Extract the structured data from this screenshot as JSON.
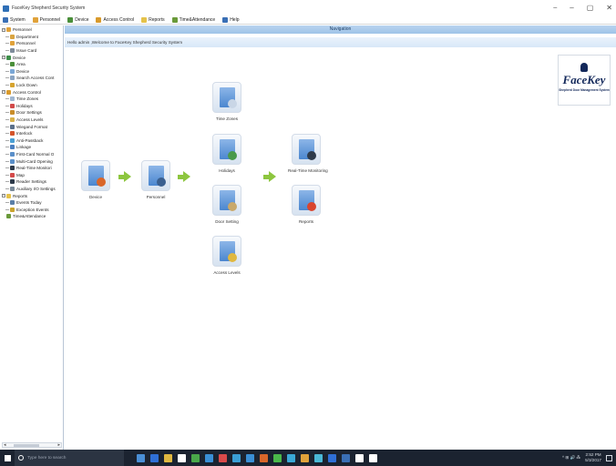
{
  "window": {
    "title": "FaceKey Shepherd Security System",
    "controls": [
      "⎯",
      "–",
      "▢",
      "✕"
    ]
  },
  "menu": [
    {
      "label": "System",
      "color": "#3a6fb5"
    },
    {
      "label": "Personnel",
      "color": "#e0a23a"
    },
    {
      "label": "Device",
      "color": "#4a8f3a"
    },
    {
      "label": "Access Control",
      "color": "#d99a2b"
    },
    {
      "label": "Reports",
      "color": "#e5c24a"
    },
    {
      "label": "Time&Attendance",
      "color": "#6a9a3a"
    },
    {
      "label": "Help",
      "color": "#3a6fb5"
    }
  ],
  "tree": [
    {
      "label": "Personnel",
      "level": 0,
      "expander": "−",
      "icon": "person-icon",
      "color": "#e0a23a"
    },
    {
      "label": "Department",
      "level": 1,
      "icon": "department-icon",
      "color": "#d9a441"
    },
    {
      "label": "Personnel",
      "level": 1,
      "icon": "person-icon",
      "color": "#e0a23a"
    },
    {
      "label": "Issue Card",
      "level": 1,
      "icon": "card-icon",
      "color": "#7f8c9a"
    },
    {
      "label": "Device",
      "level": 0,
      "expander": "−",
      "icon": "device-icon",
      "color": "#3f8f4a"
    },
    {
      "label": "Area",
      "level": 1,
      "icon": "area-icon",
      "color": "#4a8f3a"
    },
    {
      "label": "Device",
      "level": 1,
      "icon": "device-icon",
      "color": "#7aa7d6"
    },
    {
      "label": "Search Access Cont",
      "level": 1,
      "icon": "search-icon",
      "color": "#8aa4c2"
    },
    {
      "label": "Lock Down",
      "level": 1,
      "icon": "lock-icon",
      "color": "#d6a32e"
    },
    {
      "label": "Access Control",
      "level": 0,
      "expander": "−",
      "icon": "access-control-icon",
      "color": "#d99a2b"
    },
    {
      "label": "Time Zones",
      "level": 1,
      "icon": "clock-icon",
      "color": "#9fb6d2"
    },
    {
      "label": "Holidays",
      "level": 1,
      "icon": "calendar-icon",
      "color": "#d24a4a"
    },
    {
      "label": "Door Settings",
      "level": 1,
      "icon": "door-icon",
      "color": "#c98d2a"
    },
    {
      "label": "Access Levels",
      "level": 1,
      "icon": "access-levels-icon",
      "color": "#d9b24a"
    },
    {
      "label": "Wiegand Format",
      "level": 1,
      "icon": "wiegand-icon",
      "color": "#5a6f8a"
    },
    {
      "label": "Interlock",
      "level": 1,
      "icon": "interlock-icon",
      "color": "#d4552c"
    },
    {
      "label": "Anti-Passback",
      "level": 1,
      "icon": "anti-passback-icon",
      "color": "#4a9fd4"
    },
    {
      "label": "Linkage",
      "level": 1,
      "icon": "linkage-icon",
      "color": "#4a7fc0"
    },
    {
      "label": "First-Card Normal O",
      "level": 1,
      "icon": "first-card-icon",
      "color": "#5a8fc9"
    },
    {
      "label": "Multi-Card Opening",
      "level": 1,
      "icon": "multi-card-icon",
      "color": "#5a8fc9"
    },
    {
      "label": "Real-Time Monitori",
      "level": 1,
      "icon": "monitor-icon",
      "color": "#2e3a4a"
    },
    {
      "label": "Map",
      "level": 1,
      "icon": "map-icon",
      "color": "#d44a4a"
    },
    {
      "label": "Reader Settings",
      "level": 1,
      "icon": "reader-icon",
      "color": "#2e3a4a"
    },
    {
      "label": "Auxiliary I/O Settings",
      "level": 1,
      "icon": "auxiliary-io-icon",
      "color": "#7a8a9a"
    },
    {
      "label": "Reports",
      "level": 0,
      "expander": "−",
      "icon": "reports-icon",
      "color": "#e5c24a"
    },
    {
      "label": "Events Today",
      "level": 1,
      "icon": "events-icon",
      "color": "#5a7fa8"
    },
    {
      "label": "Exception Events",
      "level": 1,
      "icon": "exception-icon",
      "color": "#c9a32e"
    },
    {
      "label": "Time&Attendance",
      "level": 0,
      "icon": "attendance-icon",
      "color": "#6a9a3a"
    }
  ],
  "navigation": {
    "header": "Navigation",
    "welcome": "Hello admin ,Welcome to FaceKey Shepherd Security System"
  },
  "logo": {
    "text": "FaceKey",
    "tagline": "Shepherd Door Management System"
  },
  "flow_items": [
    {
      "key": "device",
      "label": "Device",
      "badge": "#d9662a"
    },
    {
      "key": "personnel",
      "label": "Personnel",
      "badge": "#3a5f8f"
    },
    {
      "key": "time_zones",
      "label": "Time Zones",
      "badge": "#c9d6e6"
    },
    {
      "key": "holidays",
      "label": "Holidays",
      "badge": "#4a9a4a"
    },
    {
      "key": "door_setting",
      "label": "Door Setting",
      "badge": "#c9a86a"
    },
    {
      "key": "access_levels",
      "label": "Access Levels",
      "badge": "#e0b840"
    },
    {
      "key": "realtime_monitoring",
      "label": "Real-Time Monitoring",
      "badge": "#2e3a4a"
    },
    {
      "key": "reports",
      "label": "Reports",
      "badge": "#d9452e"
    }
  ],
  "taskbar": {
    "search_placeholder": "Type here to search",
    "apps": [
      "#4a8fd6",
      "#2f6fd6",
      "#e0b840",
      "#ffffff",
      "#4aa84a",
      "#3a8fd6",
      "#d94a4a",
      "#3a9fd6",
      "#3a8fd6",
      "#d9662a",
      "#4ab84a",
      "#3aa8d6",
      "#e0a23a",
      "#4ab8d6",
      "#2f6fd6",
      "#3a6fb5",
      "#ffffff",
      "#ffffff"
    ],
    "tray_icons": "^ ⊞ 🔊 ⁂",
    "time": "2:52 PM",
    "date": "5/3/2017"
  }
}
